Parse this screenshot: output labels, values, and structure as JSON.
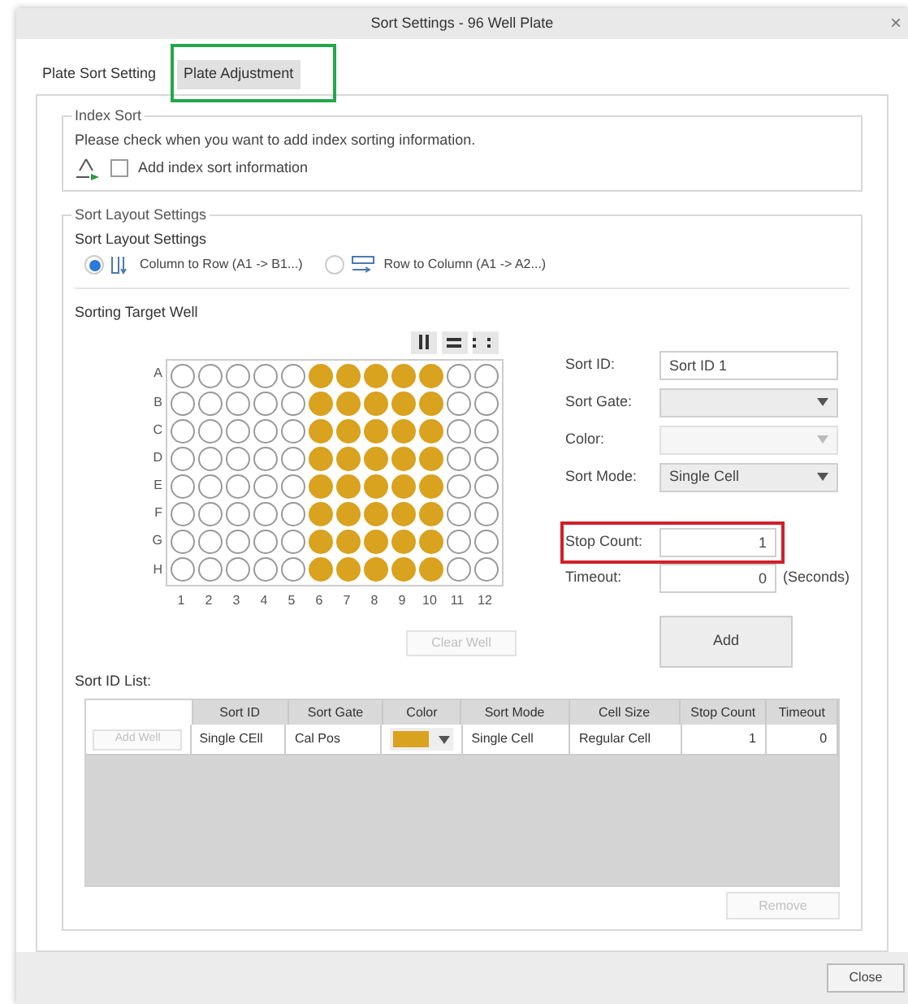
{
  "window": {
    "title": "Sort Settings - 96 Well Plate",
    "close": "×"
  },
  "tabs": [
    {
      "label": "Plate Sort Setting",
      "selected": true,
      "highlighted": false
    },
    {
      "label": "Plate Adjustment",
      "selected": false,
      "highlighted": true
    }
  ],
  "index_sort": {
    "title": "Index Sort",
    "hint": "Please check when you want to add index sorting information.",
    "checkbox": {
      "label": "Add index sort information",
      "checked": false
    }
  },
  "sort_layout": {
    "group_title": "Sort Layout Settings",
    "title": "Sort Layout Settings",
    "options": [
      {
        "label": "Column to Row (A1 -> B1...)",
        "selected": true,
        "kind": "column"
      },
      {
        "label": "Row to Column (A1 -> A2...)",
        "selected": false,
        "kind": "row"
      }
    ]
  },
  "target": {
    "title": "Sorting Target Well",
    "columns": [
      "1",
      "2",
      "3",
      "4",
      "5",
      "6",
      "7",
      "8",
      "9",
      "10",
      "11",
      "12"
    ],
    "rows": [
      {
        "label": "A",
        "filled": [
          false,
          false,
          false,
          false,
          false,
          true,
          true,
          true,
          true,
          true,
          false,
          false
        ]
      },
      {
        "label": "B",
        "filled": [
          false,
          false,
          false,
          false,
          false,
          true,
          true,
          true,
          true,
          true,
          false,
          false
        ]
      },
      {
        "label": "C",
        "filled": [
          false,
          false,
          false,
          false,
          false,
          true,
          true,
          true,
          true,
          true,
          false,
          false
        ]
      },
      {
        "label": "D",
        "filled": [
          false,
          false,
          false,
          false,
          false,
          true,
          true,
          true,
          true,
          true,
          false,
          false
        ]
      },
      {
        "label": "E",
        "filled": [
          false,
          false,
          false,
          false,
          false,
          true,
          true,
          true,
          true,
          true,
          false,
          false
        ]
      },
      {
        "label": "F",
        "filled": [
          false,
          false,
          false,
          false,
          false,
          true,
          true,
          true,
          true,
          true,
          false,
          false
        ]
      },
      {
        "label": "G",
        "filled": [
          false,
          false,
          false,
          false,
          false,
          true,
          true,
          true,
          true,
          true,
          false,
          false
        ]
      },
      {
        "label": "H",
        "filled": [
          false,
          false,
          false,
          false,
          false,
          true,
          true,
          true,
          true,
          true,
          false,
          false
        ]
      }
    ],
    "clear_button": {
      "label": "Clear Well",
      "disabled": true
    }
  },
  "form": {
    "fields": [
      {
        "label": "Sort ID:",
        "kind": "text",
        "value": "Sort ID 1"
      },
      {
        "label": "Sort Gate:",
        "kind": "select",
        "disabled": false
      },
      {
        "label": "Color:",
        "kind": "select",
        "disabled": true
      },
      {
        "label": "Sort Mode:",
        "kind": "select",
        "value": "Single Cell",
        "disabled": false
      },
      {
        "label": "Stop Count:",
        "kind": "number",
        "value": "1",
        "highlighted": true
      },
      {
        "label": "Timeout:",
        "kind": "number",
        "value": "0",
        "unit": "(Seconds)"
      }
    ],
    "add_button": "Add"
  },
  "sort_id_list": {
    "title": "Sort ID List:",
    "columns": [
      "Sort ID",
      "Sort Gate",
      "Color",
      "Sort Mode",
      "Cell Size",
      "Stop Count",
      "Timeout"
    ],
    "rows": [
      {
        "action": {
          "label": "Add Well",
          "disabled": true
        },
        "sort_id": "Single CEll",
        "sort_gate": "Cal Pos",
        "color": "#d9a21f",
        "sort_mode": "Single Cell",
        "cell_size": "Regular Cell",
        "stop_count": "1",
        "timeout": "0"
      }
    ],
    "remove_button": {
      "label": "Remove",
      "disabled": true
    }
  },
  "footer": {
    "close_button": "Close"
  }
}
